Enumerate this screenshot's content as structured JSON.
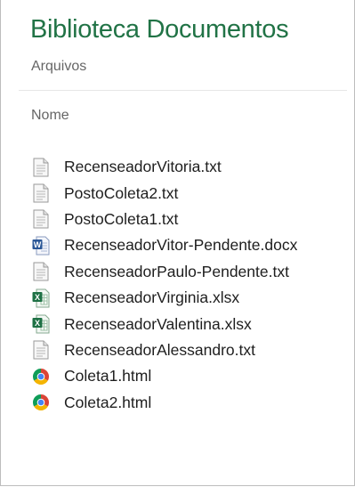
{
  "header": {
    "title": "Biblioteca Documentos",
    "subtitle": "Arquivos"
  },
  "list": {
    "column_header": "Nome",
    "items": [
      {
        "label": "RecenseadorVitoria.txt",
        "icon": "text-file-icon"
      },
      {
        "label": "PostoColeta2.txt",
        "icon": "text-file-icon"
      },
      {
        "label": "PostoColeta1.txt",
        "icon": "text-file-icon"
      },
      {
        "label": "RecenseadorVitor-Pendente.docx",
        "icon": "word-document-icon"
      },
      {
        "label": "RecenseadorPaulo-Pendente.txt",
        "icon": "text-file-icon"
      },
      {
        "label": "RecenseadorVirginia.xlsx",
        "icon": "excel-spreadsheet-icon"
      },
      {
        "label": "RecenseadorValentina.xlsx",
        "icon": "excel-spreadsheet-icon"
      },
      {
        "label": "RecenseadorAlessandro.txt",
        "icon": "text-file-icon"
      },
      {
        "label": "Coleta1.html",
        "icon": "chrome-browser-icon"
      },
      {
        "label": "Coleta2.html",
        "icon": "chrome-browser-icon"
      }
    ]
  },
  "colors": {
    "title": "#217346",
    "muted_text": "#666666",
    "word_blue": "#2b5797",
    "excel_green": "#1e7145"
  }
}
